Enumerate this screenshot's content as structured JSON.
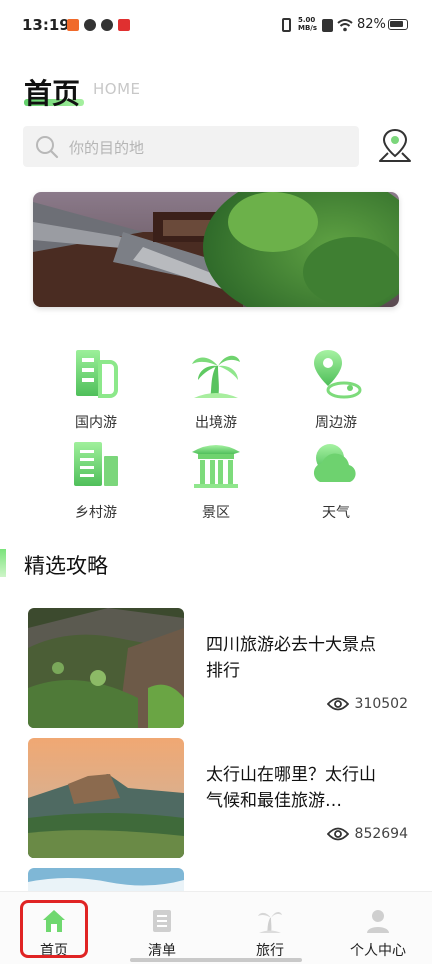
{
  "status_bar": {
    "time": "13:19",
    "net_speed": "5.00\nMB/s",
    "battery": "82%"
  },
  "header": {
    "title": "首页",
    "subtitle": "HOME"
  },
  "search": {
    "placeholder": "你的目的地"
  },
  "categories": [
    {
      "label": "国内游",
      "icon": "building-icon"
    },
    {
      "label": "出境游",
      "icon": "palm-tree-icon"
    },
    {
      "label": "周边游",
      "icon": "map-pin-icon"
    },
    {
      "label": "乡村游",
      "icon": "village-icon"
    },
    {
      "label": "景区",
      "icon": "pavilion-icon"
    },
    {
      "label": "天气",
      "icon": "cloud-icon"
    }
  ],
  "section": {
    "title": "精选攻略"
  },
  "articles": [
    {
      "title": "四川旅游必去十大景点排行",
      "views": "310502"
    },
    {
      "title": "太行山在哪里？太行山气候和最佳旅游…",
      "views": "852694"
    }
  ],
  "tabs": [
    {
      "label": "首页",
      "icon": "home-icon",
      "active": true
    },
    {
      "label": "清单",
      "icon": "list-icon",
      "active": false
    },
    {
      "label": "旅行",
      "icon": "travel-icon",
      "active": false
    },
    {
      "label": "个人中心",
      "icon": "user-icon",
      "active": false
    }
  ],
  "colors": {
    "accent": "#6fd86f",
    "highlight": "#e02424"
  }
}
